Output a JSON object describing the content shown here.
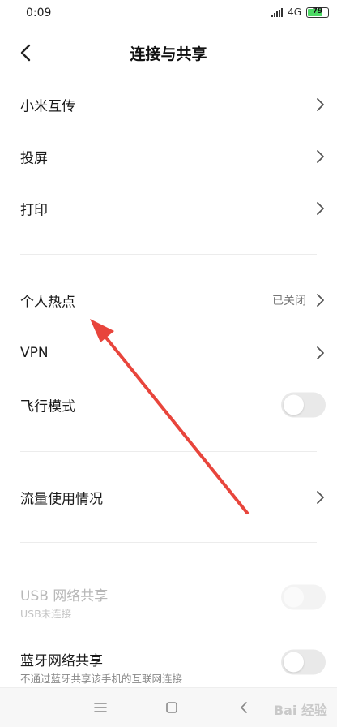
{
  "status_bar": {
    "time": "0:09",
    "network": "4G",
    "battery": "79",
    "battery_level": 0.79
  },
  "header": {
    "title": "连接与共享"
  },
  "items": [
    {
      "label": "小米互传"
    },
    {
      "label": "投屏"
    },
    {
      "label": "打印"
    },
    {
      "label": "个人热点",
      "value": "已关闭"
    },
    {
      "label": "VPN"
    },
    {
      "label": "飞行模式",
      "toggle": false
    },
    {
      "label": "流量使用情况"
    },
    {
      "label": "USB 网络共享",
      "sub": "USB未连接",
      "toggle": false,
      "disabled": true
    },
    {
      "label": "蓝牙网络共享",
      "sub": "不通过蓝牙共享该手机的互联网连接",
      "toggle": false
    }
  ],
  "watermark": "Bai 经验",
  "colors": {
    "accent_arrow": "#e8453c",
    "battery_fill": "#4cd964"
  }
}
